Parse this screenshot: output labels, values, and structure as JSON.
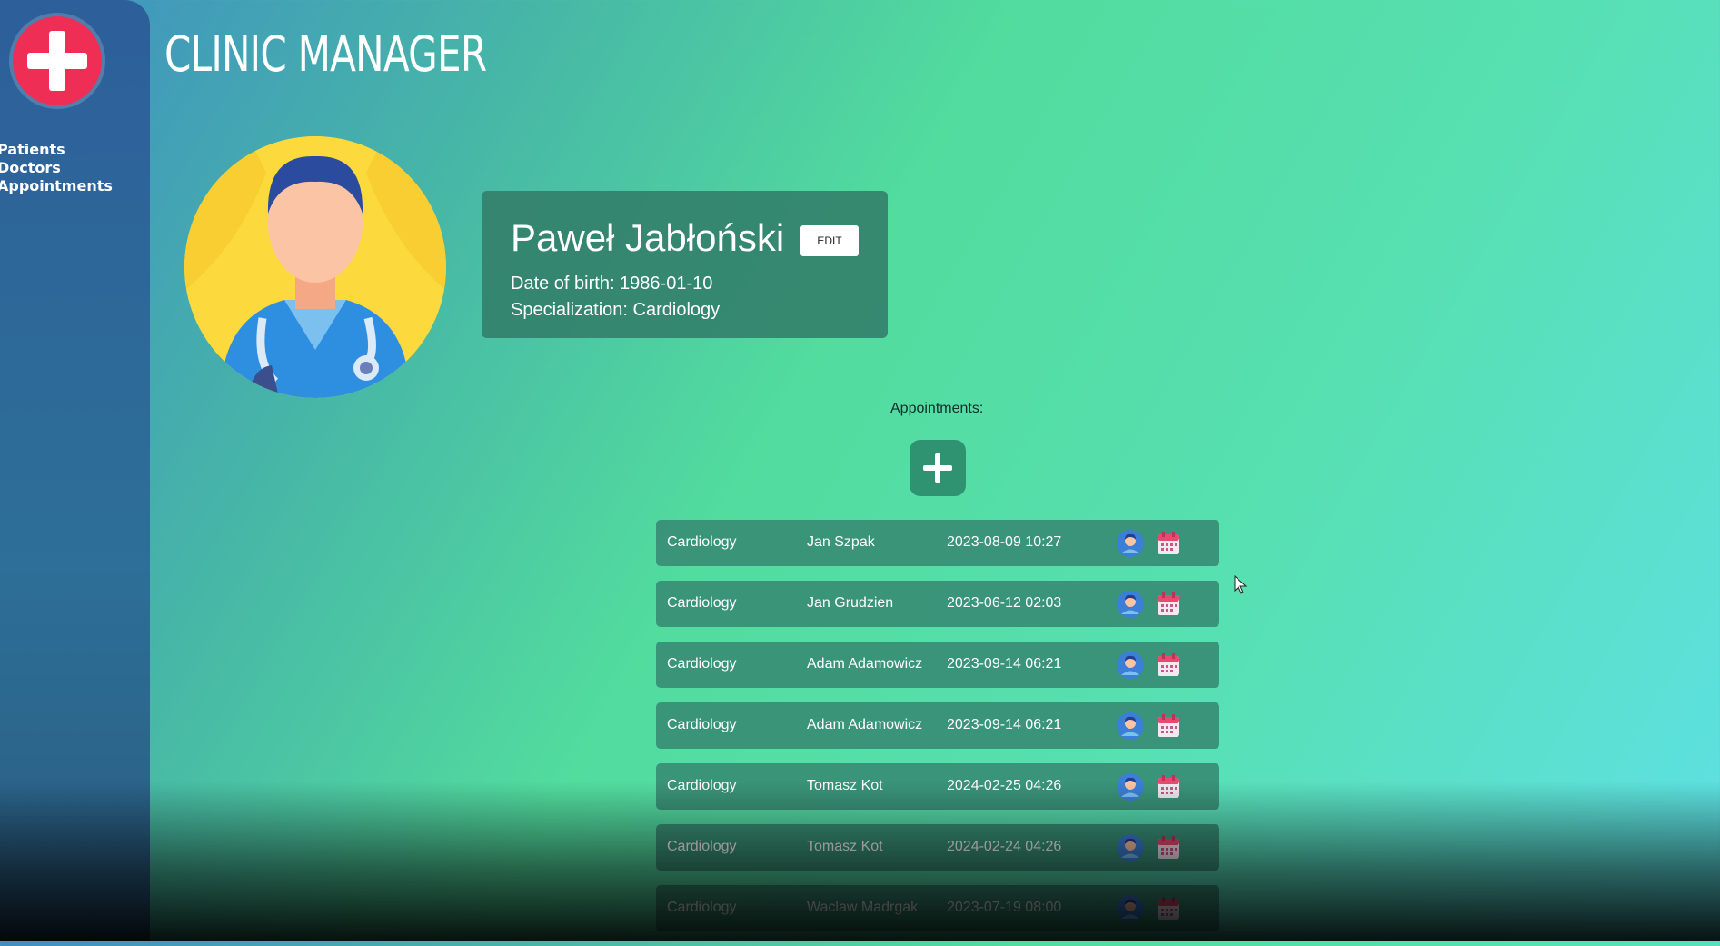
{
  "sidebar": {
    "nav": [
      {
        "label": "Patients"
      },
      {
        "label": "Doctors"
      },
      {
        "label": "Appointments"
      }
    ]
  },
  "header": {
    "title": "CLINIC MANAGER"
  },
  "doctor": {
    "name": "Paweł Jabłoński",
    "edit_label": "EDIT",
    "dob": "Date of birth: 1986-01-10",
    "specialization": "Specialization: Cardiology"
  },
  "appointments": {
    "heading": "Appointments:",
    "rows": [
      {
        "specialization": "Cardiology",
        "patient": "Jan Szpak",
        "datetime": "2023-08-09 10:27"
      },
      {
        "specialization": "Cardiology",
        "patient": "Jan Grudzien",
        "datetime": "2023-06-12 02:03"
      },
      {
        "specialization": "Cardiology",
        "patient": "Adam Adamowicz",
        "datetime": "2023-09-14 06:21"
      },
      {
        "specialization": "Cardiology",
        "patient": "Adam Adamowicz",
        "datetime": "2023-09-14 06:21"
      },
      {
        "specialization": "Cardiology",
        "patient": "Tomasz Kot",
        "datetime": "2024-02-25 04:26"
      },
      {
        "specialization": "Cardiology",
        "patient": "Tomasz Kot",
        "datetime": "2024-02-24 04:26"
      },
      {
        "specialization": "Cardiology",
        "patient": "Waclaw Madrgak",
        "datetime": "2023-07-19 08:00"
      }
    ]
  },
  "colors": {
    "logo": "#ef2e55",
    "sidebar": "#2d5f9a",
    "card": "#327d69",
    "accent": "#2f9271"
  },
  "icons": {
    "logo": "medical-cross-icon",
    "row_patient": "patient-avatar-icon",
    "row_calendar": "calendar-icon",
    "add": "plus-icon"
  }
}
